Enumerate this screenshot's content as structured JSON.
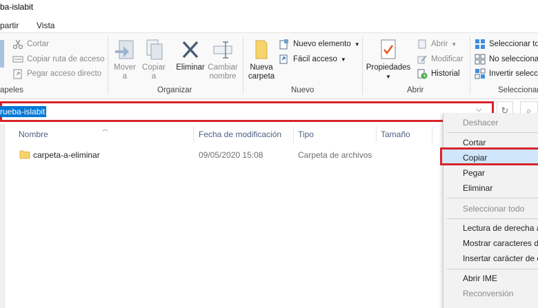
{
  "window": {
    "title": "ba-islabit"
  },
  "tabs": [
    "partir",
    "Vista"
  ],
  "ribbon": {
    "clipboard": {
      "label": "apeles",
      "cut": "Cortar",
      "copy_path": "Copiar ruta de acceso",
      "paste_shortcut": "Pegar acceso directo"
    },
    "organize": {
      "label": "Organizar",
      "move_to": [
        "Mover",
        "a"
      ],
      "copy_to": [
        "Copiar",
        "a"
      ],
      "delete": "Eliminar",
      "rename": [
        "Cambiar",
        "nombre"
      ]
    },
    "new": {
      "label": "Nuevo",
      "new_folder": [
        "Nueva",
        "carpeta"
      ],
      "new_item": "Nuevo elemento",
      "easy_access": "Fácil acceso"
    },
    "open": {
      "label": "Abrir",
      "properties": "Propiedades",
      "open": "Abrir",
      "modify": "Modificar",
      "history": "Historial"
    },
    "select": {
      "label": "Seleccionar",
      "select_all": "Seleccionar to",
      "select_none": "No seleccionar",
      "invert": "Invertir selecci"
    }
  },
  "address": {
    "text": "rueba-islabit"
  },
  "columns": {
    "name": "Nombre",
    "modified": "Fecha de modificación",
    "type": "Tipo",
    "size": "Tamaño"
  },
  "files": [
    {
      "name": "carpeta-a-eliminar",
      "modified": "09/05/2020 15:08",
      "type": "Carpeta de archivos",
      "size": ""
    }
  ],
  "context_menu": {
    "undo": "Deshacer",
    "cut": "Cortar",
    "copy": "Copiar",
    "paste": "Pegar",
    "delete": "Eliminar",
    "select_all": "Seleccionar todo",
    "rtl": "Lectura de derecha a",
    "show_unicode": "Mostrar caracteres de",
    "insert_unicode": "Insertar carácter de c",
    "open_ime": "Abrir IME",
    "reconversion": "Reconversión"
  },
  "colors": {
    "highlight_red": "#d8232a",
    "selection_blue": "#0078d7",
    "menu_hover": "#cfe6fb"
  }
}
